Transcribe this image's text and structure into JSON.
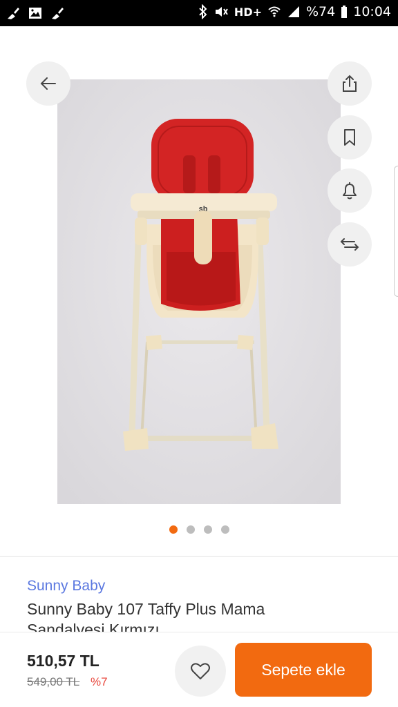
{
  "status_bar": {
    "left_icons": [
      "broom-icon",
      "image-icon",
      "broom-icon"
    ],
    "network": "HD+",
    "battery": "%74",
    "time": "10:04"
  },
  "product": {
    "brand": "Sunny Baby",
    "title": "Sunny Baby 107 Taffy Plus Mama Sandalyesi Kırmızı",
    "image_logo": "sb",
    "image_count": 4,
    "active_image": 1
  },
  "actions": {
    "back": "arrow-left-icon",
    "share": "share-icon",
    "bookmark": "bookmark-icon",
    "notify": "bell-icon",
    "compare": "swap-arrows-icon"
  },
  "pricing": {
    "price": "510,57 TL",
    "old_price": "549,00 TL",
    "discount": "%7"
  },
  "cart": {
    "add_label": "Sepete ekle"
  },
  "colors": {
    "accent": "#f26a10",
    "brand_link": "#5b78e0",
    "discount": "#e8463b"
  }
}
